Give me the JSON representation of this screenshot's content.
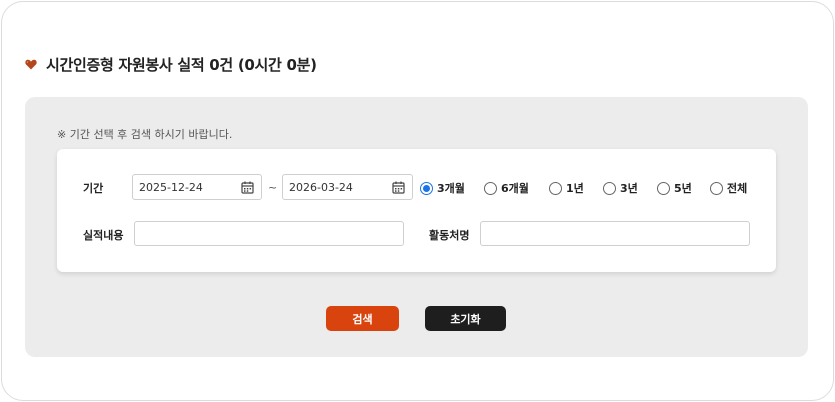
{
  "header": {
    "title": "시간인증형 자원봉사 실적 0건 (0시간 0분)",
    "icon": "heart-icon",
    "icon_color": "#b5451b"
  },
  "panel": {
    "notice": "※ 기간 선택 후 검색 하시기 바랍니다."
  },
  "filters": {
    "period_label": "기간",
    "start_date": "2025-12-24",
    "separator": "~",
    "end_date": "2026-03-24",
    "period_options": [
      "3개월",
      "6개월",
      "1년",
      "3년",
      "5년",
      "전체"
    ],
    "selected_option": "3개월",
    "content_label": "실적내용",
    "content_value": "",
    "place_label": "활동처명",
    "place_value": ""
  },
  "actions": {
    "search_label": "검색",
    "reset_label": "초기화",
    "search_color": "#d9430e",
    "reset_color": "#1e1e1e"
  },
  "colors": {
    "panel_bg": "#ececec",
    "radio_accent": "#1a73e8"
  }
}
